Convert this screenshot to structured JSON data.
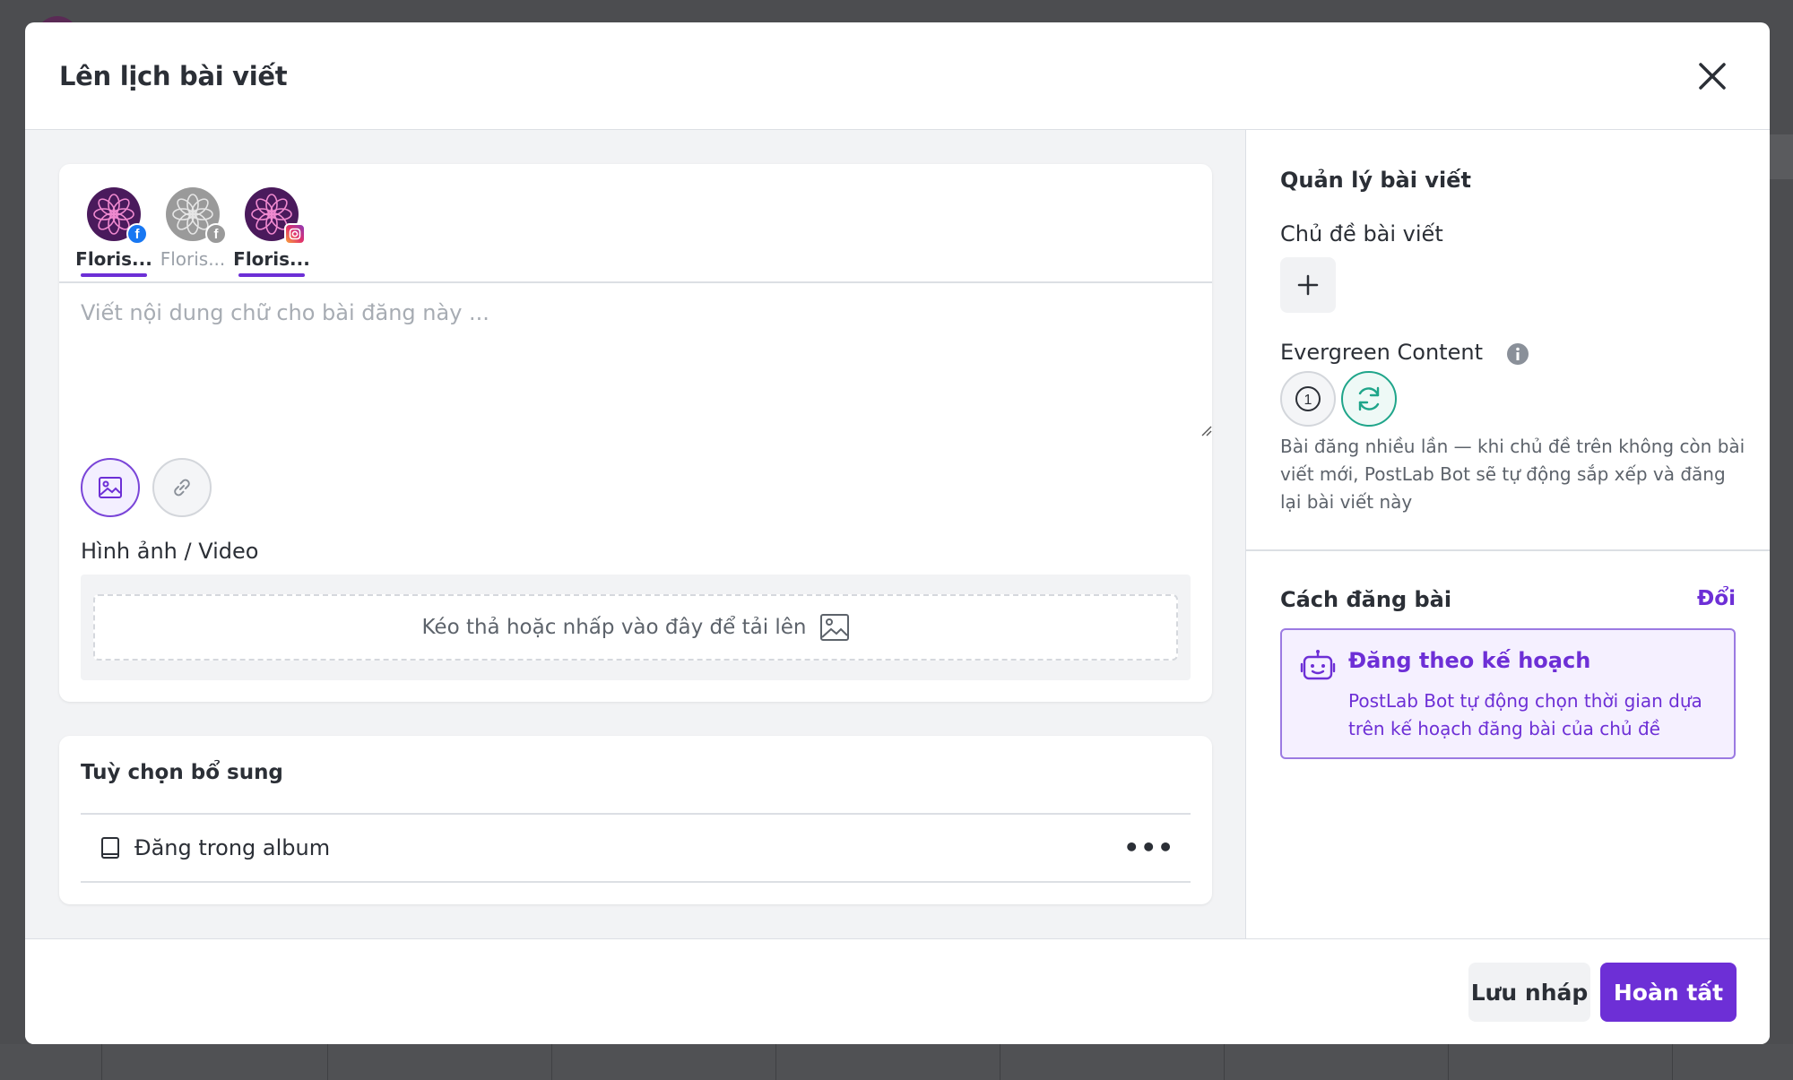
{
  "modal": {
    "title": "Lên lịch bài viết"
  },
  "accounts": [
    {
      "label": "Floris...",
      "network": "facebook",
      "selected": true
    },
    {
      "label": "Floris...",
      "network": "facebook",
      "selected": false
    },
    {
      "label": "Floris...",
      "network": "instagram",
      "selected": true
    }
  ],
  "composer": {
    "placeholder": "Viết nội dung chữ cho bài đăng này ...",
    "value": "",
    "media_label": "Hình ảnh / Video",
    "dropzone_text": "Kéo thả hoặc nhấp vào đây để tải lên"
  },
  "extras": {
    "title": "Tuỳ chọn bổ sung",
    "album_label": "Đăng trong album",
    "more": "•••"
  },
  "post_management": {
    "title": "Quản lý bài viết",
    "topic_label": "Chủ đề bài viết",
    "evergreen_label": "Evergreen Content",
    "evergreen_once_symbol": "1",
    "evergreen_selected": "repeat",
    "evergreen_desc": "Bài đăng nhiều lần — khi chủ đề trên không còn bài viết mới, PostLab Bot sẽ tự động sắp xếp và đăng lại bài viết này"
  },
  "posting_method": {
    "title": "Cách đăng bài",
    "change_label": "Đổi",
    "option_title": "Đăng theo kế hoạch",
    "option_desc": "PostLab Bot tự động chọn thời gian dựa trên kế hoạch đăng bài của chủ đề"
  },
  "footer": {
    "draft_label": "Lưu nháp",
    "done_label": "Hoàn tất"
  },
  "colors": {
    "accent": "#6d2fd6",
    "evergreen_active": "#1fa58a",
    "facebook": "#1877f2",
    "instagram": "#e1306c"
  },
  "icons": {
    "close": "close-icon",
    "image": "image-icon",
    "link": "link-icon",
    "album": "book-icon",
    "add": "plus-icon",
    "info": "info-icon",
    "once": "number-one-icon",
    "repeat": "refresh-icon",
    "bot": "robot-icon"
  }
}
